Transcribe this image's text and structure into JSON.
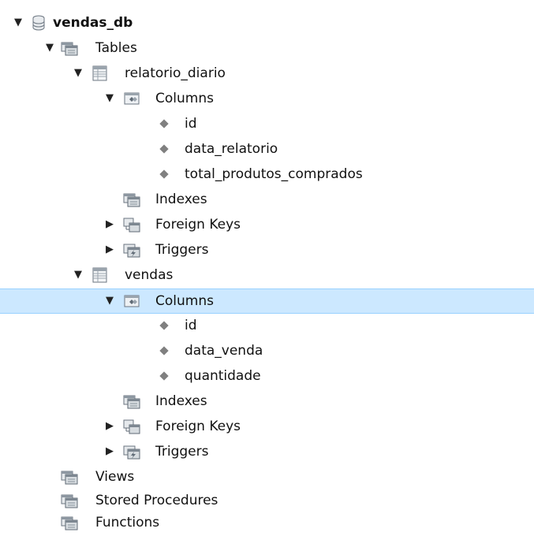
{
  "tree": {
    "database": "vendas_db",
    "tables_label": "Tables",
    "table1": {
      "name": "relatorio_diario",
      "columns_label": "Columns",
      "columns": [
        "id",
        "data_relatorio",
        "total_produtos_comprados"
      ],
      "indexes_label": "Indexes",
      "foreign_keys_label": "Foreign Keys",
      "triggers_label": "Triggers"
    },
    "table2": {
      "name": "vendas",
      "columns_label": "Columns",
      "columns": [
        "id",
        "data_venda",
        "quantidade"
      ],
      "indexes_label": "Indexes",
      "foreign_keys_label": "Foreign Keys",
      "triggers_label": "Triggers"
    },
    "views_label": "Views",
    "stored_procedures_label": "Stored Procedures",
    "functions_label": "Functions"
  },
  "colors": {
    "selection_bg": "#cce8ff",
    "selection_border": "#99d1ff",
    "folder_icon": "#7a8590",
    "bullet": "#808080"
  },
  "icons": {
    "expand": "triangle-down",
    "collapse": "triangle-right",
    "database": "database-icon",
    "folder": "folder-icon",
    "table": "table-icon",
    "column_bullet": "diamond-icon"
  }
}
